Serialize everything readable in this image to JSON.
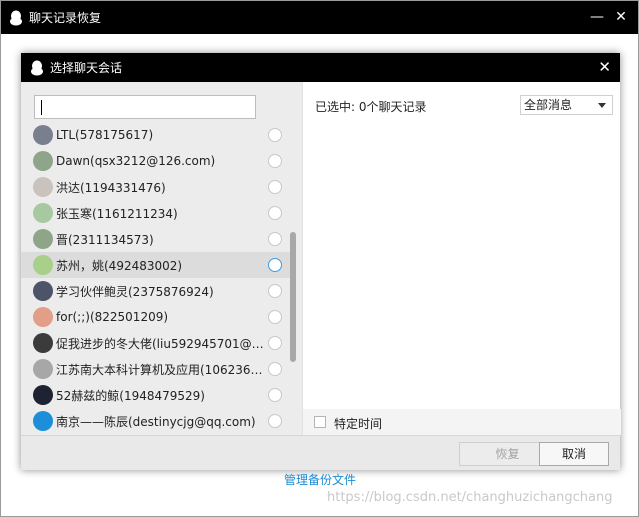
{
  "outer_window": {
    "title": "聊天记录恢复",
    "minimize_glyph": "—",
    "close_glyph": "✕"
  },
  "dialog": {
    "title": "选择聊天会话",
    "close_glyph": "✕",
    "search": {
      "value": "",
      "placeholder": ""
    },
    "contacts": [
      {
        "name": "LTL(578175617)",
        "avatar_color": "#7a7f8d"
      },
      {
        "name": "Dawn(qsx3212@126.com)",
        "avatar_color": "#8fa58a"
      },
      {
        "name": "洪达(1194331476)",
        "avatar_color": "#c9c2bd"
      },
      {
        "name": "张玉寒(1161211234)",
        "avatar_color": "#a8c9a0"
      },
      {
        "name": "晋(2311134573)",
        "avatar_color": "#8fa58a"
      },
      {
        "name": "苏州，姚(492483002)",
        "avatar_color": "#a9d08a",
        "selected": true
      },
      {
        "name": "学习伙伴鲍灵(2375876924)",
        "avatar_color": "#4d5368"
      },
      {
        "name": "for(;;)(822501209)",
        "avatar_color": "#e39e88"
      },
      {
        "name": "促我进步的冬大佬(liu592945701@qq.…",
        "avatar_color": "#3b3b3b"
      },
      {
        "name": "江苏南大本科计算机及应用(10623681…",
        "avatar_color": "#a7a7a7"
      },
      {
        "name": "52赫兹的鲸(1948479529)",
        "avatar_color": "#1d2330"
      },
      {
        "name": "南京——陈辰(destinycjg@qq.com)",
        "avatar_color": "#1d8fd9"
      }
    ],
    "selected_status": "已选中: 0个聊天记录",
    "filter_dropdown": {
      "value": "全部消息"
    },
    "specific_time_label": "特定时间",
    "buttons": {
      "restore": "恢复",
      "cancel": "取消"
    }
  },
  "manage_backup_link": "管理备份文件",
  "watermark": "https://blog.csdn.net/changhuzichangchang",
  "colors": {
    "titlebar": "#000000",
    "link": "#1a8bd4",
    "radio_active": "#3a9be6"
  }
}
